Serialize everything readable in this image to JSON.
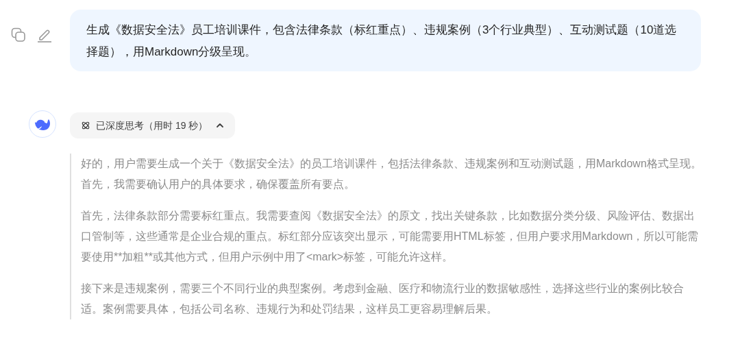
{
  "user_message": {
    "text": "生成《数据安全法》员工培训课件，包含法律条款（标红重点）、违规案例（3个行业典型）、互动测试题（10道选择题），用Markdown分级呈现。"
  },
  "thinking": {
    "label": "已深度思考（用时 19 秒）",
    "expanded": true,
    "paragraphs": [
      "好的，用户需要生成一个关于《数据安全法》的员工培训课件，包括法律条款、违规案例和互动测试题，用Markdown格式呈现。首先，我需要确认用户的具体要求，确保覆盖所有要点。",
      "首先，法律条款部分需要标红重点。我需要查阅《数据安全法》的原文，找出关键条款，比如数据分类分级、风险评估、数据出口管制等，这些通常是企业合规的重点。标红部分应该突出显示，可能需要用HTML标签，但用户要求用Markdown，所以可能需要使用**加粗**或其他方式，但用户示例中用了<mark>标签，可能允许这样。",
      "接下来是违规案例，需要三个不同行业的典型案例。考虑到金融、医疗和物流行业的数据敏感性，选择这些行业的案例比较合适。案例需要具体，包括公司名称、违规行为和处罚结果，这样员工更容易理解后果。"
    ]
  }
}
